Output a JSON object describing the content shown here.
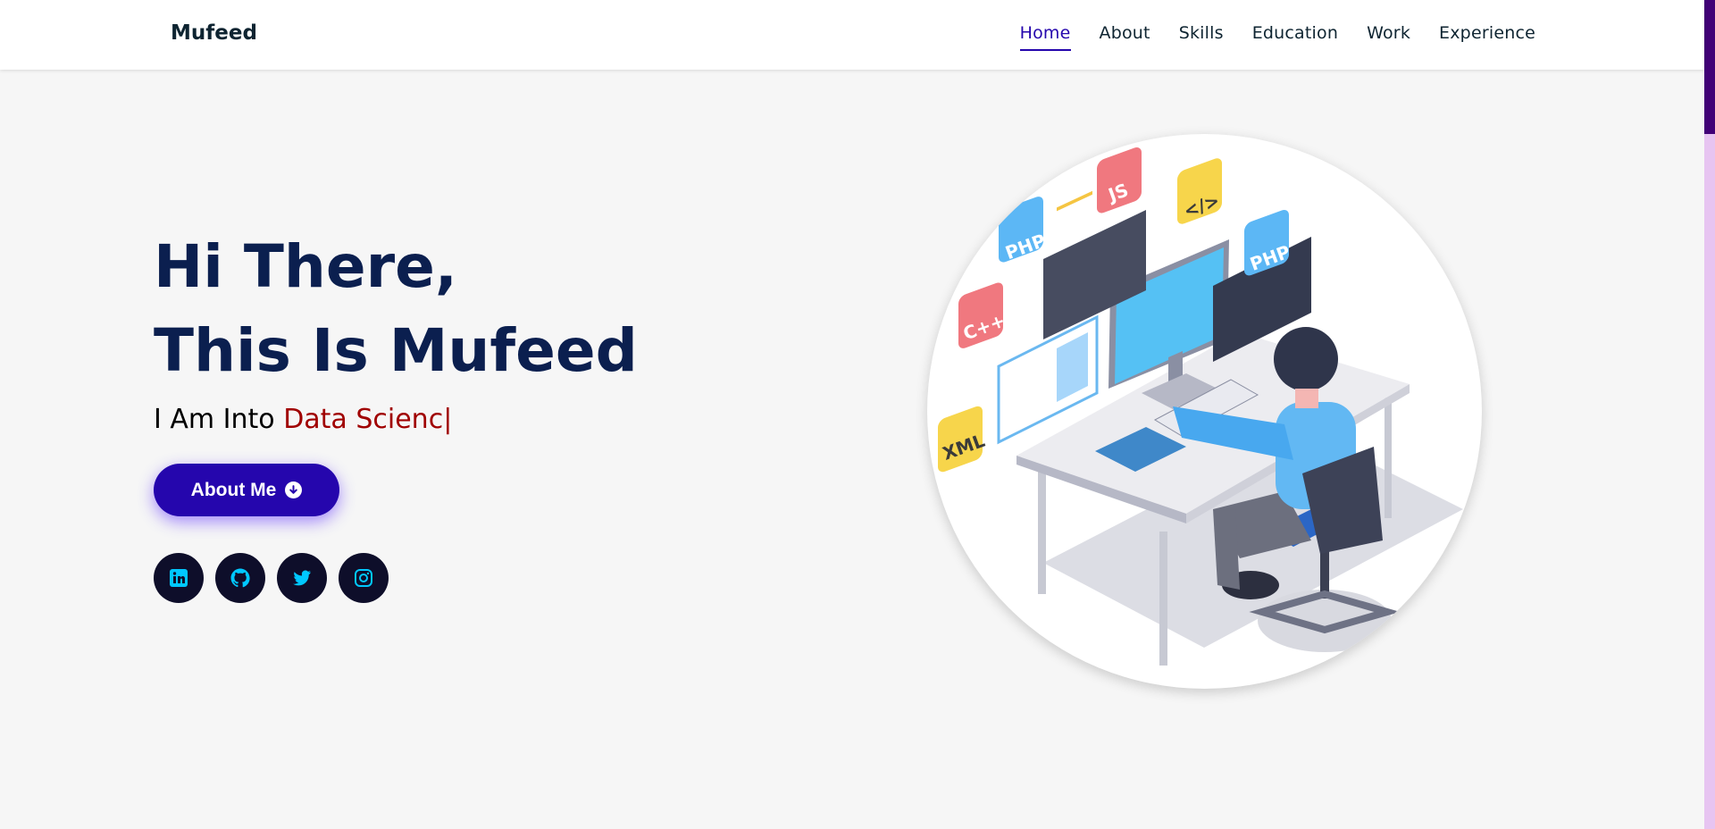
{
  "brand": "Mufeed",
  "nav": {
    "items": [
      "Home",
      "About",
      "Skills",
      "Education",
      "Work",
      "Experience"
    ],
    "active": "Home"
  },
  "hero": {
    "greeting_line1": "Hi There,",
    "greeting_prefix": "This Is ",
    "name": "Mufeed",
    "typed_prefix": "I Am Into ",
    "typed_text": "Data Scienc",
    "cursor": "|",
    "about_button": "About Me"
  },
  "socials": [
    "linkedin-icon",
    "github-icon",
    "twitter-icon",
    "instagram-icon"
  ],
  "illustration_labels": [
    "PHP",
    "JS",
    "</>",
    "PHP",
    "C++",
    "XML"
  ],
  "colors": {
    "accent": "#2506ad",
    "heading": "#0b1f4f",
    "typed": "#a00000",
    "social_bg": "#0e0e2a",
    "social_icon": "#00c8ff",
    "scroll_thumb": "#420177"
  }
}
